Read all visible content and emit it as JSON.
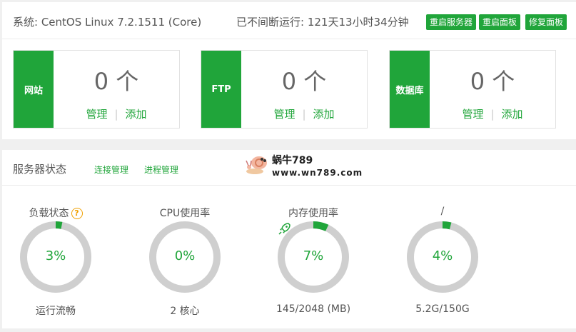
{
  "header": {
    "system": "系统: CentOS Linux 7.2.1511 (Core)",
    "uptime": "已不间断运行: 121天13小时34分钟",
    "buttons": [
      "重启服务器",
      "重启面板",
      "修复面板"
    ]
  },
  "cards": [
    {
      "tab": "网站",
      "count": "0 个",
      "manage": "管理",
      "add": "添加"
    },
    {
      "tab": "FTP",
      "count": "0 个",
      "manage": "管理",
      "add": "添加"
    },
    {
      "tab": "数据库",
      "count": "0 个",
      "manage": "管理",
      "add": "添加"
    }
  ],
  "status": {
    "title": "服务器状态",
    "links": [
      "连接管理",
      "进程管理"
    ],
    "watermark": {
      "name": "蜗牛789",
      "url": "www.wn789.com"
    },
    "gauges": [
      {
        "label": "负载状态",
        "value": "3%",
        "percent": 3,
        "caption": "运行流畅",
        "icon": "help-icon"
      },
      {
        "label": "CPU使用率",
        "value": "0%",
        "percent": 0,
        "caption": "2 核心"
      },
      {
        "label": "内存使用率",
        "value": "7%",
        "percent": 7,
        "caption": "145/2048 (MB)",
        "icon": "rocket-icon"
      },
      {
        "label": "/",
        "value": "4%",
        "percent": 4,
        "caption": "5.2G/150G"
      }
    ]
  },
  "colors": {
    "accent": "#20a53a",
    "ring_track": "#cfcfcf",
    "help": "#f0a000"
  }
}
